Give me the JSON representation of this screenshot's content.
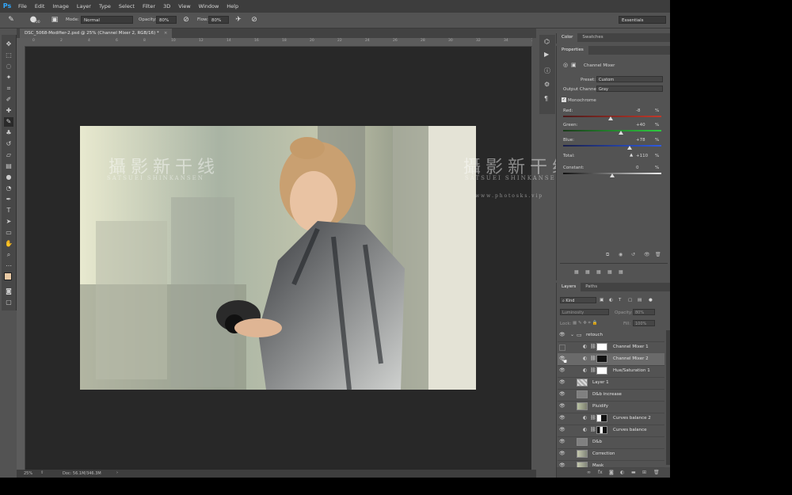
{
  "menubar": {
    "logo": "Ps",
    "items": [
      "File",
      "Edit",
      "Image",
      "Layer",
      "Type",
      "Select",
      "Filter",
      "3D",
      "View",
      "Window",
      "Help"
    ]
  },
  "options_bar": {
    "brush_size": "700",
    "mode_label": "Mode:",
    "mode_value": "Normal",
    "opacity_label": "Opacity:",
    "opacity_value": "80%",
    "flow_label": "Flow:",
    "flow_value": "80%",
    "workspace": "Essentials"
  },
  "document": {
    "tab_title": "DSC_5068-Modifier-2.psd @ 25% (Channel Mixer 2, RGB/16) *",
    "close_glyph": "×",
    "zoom": "25%",
    "doc_info": "Doc: 56.1M/346.3M",
    "ruler_ticks": [
      "0",
      "2",
      "4",
      "6",
      "8",
      "10",
      "12",
      "14",
      "16",
      "18",
      "20",
      "22",
      "24",
      "26",
      "28",
      "30",
      "32",
      "34",
      "36"
    ]
  },
  "watermark": {
    "chinese": "攝影新干线",
    "romaji": "SATSUEI SHINKANSEN",
    "url": "w w w . p h o t o s k s . v i p"
  },
  "top_panel": {
    "tabs": [
      "Color",
      "Swatches"
    ]
  },
  "properties": {
    "tab": "Properties",
    "title": "Channel Mixer",
    "preset_label": "Preset:",
    "preset_value": "Custom",
    "output_label": "Output Channel:",
    "output_value": "Gray",
    "monochrome_label": "Monochrome",
    "monochrome_checked": true,
    "channels": [
      {
        "label": "Red:",
        "value": "-8",
        "unit": "%",
        "fraction": 0.48,
        "color": "#c0392b"
      },
      {
        "label": "Green:",
        "value": "+40",
        "unit": "%",
        "fraction": 0.59,
        "color": "#2ecc40"
      },
      {
        "label": "Blue:",
        "value": "+78",
        "unit": "%",
        "fraction": 0.68,
        "color": "#2f5be0"
      }
    ],
    "total_label": "Total:",
    "total_value": "+110",
    "total_unit": "%",
    "constant_label": "Constant:",
    "constant_value": "0",
    "constant_unit": "%"
  },
  "layers_panel": {
    "tabs": [
      "Layers",
      "Paths"
    ],
    "kind_filter": "Kind",
    "blend_mode": "Luminosity",
    "opacity_label": "Opacity:",
    "opacity_value": "80%",
    "lock_label": "Lock:",
    "fill_label": "Fill:",
    "fill_value": "100%",
    "layers": [
      {
        "name": "retouch",
        "type": "group",
        "visible": true
      },
      {
        "name": "Channel Mixer 1",
        "type": "adjustment",
        "visible": false
      },
      {
        "name": "Channel Mixer 2",
        "type": "adjustment",
        "visible": true,
        "selected": true
      },
      {
        "name": "Hue/Saturation 1",
        "type": "adjustment",
        "visible": true
      },
      {
        "name": "Layer 1",
        "type": "pixel",
        "visible": true
      },
      {
        "name": "D&b increase",
        "type": "gray",
        "visible": true
      },
      {
        "name": "Pluidify",
        "type": "photo",
        "visible": true
      },
      {
        "name": "Curves balance 2",
        "type": "adjustment",
        "visible": true
      },
      {
        "name": "Curves balance",
        "type": "adjustment",
        "visible": true
      },
      {
        "name": "D&b",
        "type": "gray",
        "visible": true
      },
      {
        "name": "Correction",
        "type": "photo",
        "visible": true
      },
      {
        "name": "Mask",
        "type": "photo",
        "visible": true
      }
    ]
  }
}
